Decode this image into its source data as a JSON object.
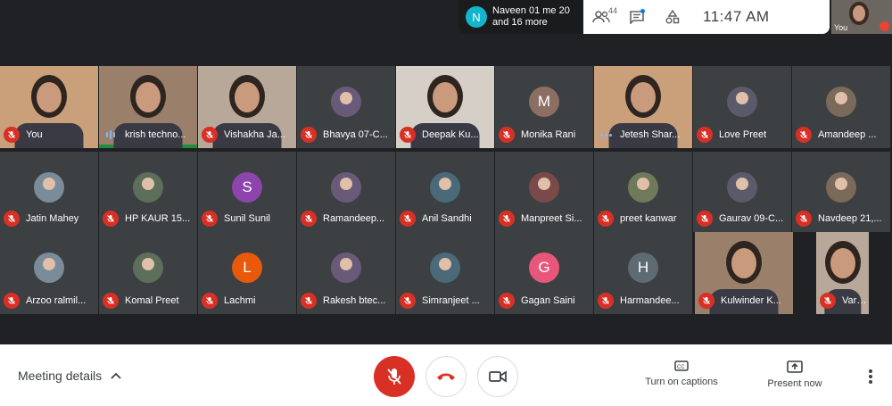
{
  "notification": {
    "avatar_letter": "N",
    "line1": "Naveen 01 me 20",
    "line2": "and 16 more"
  },
  "topbar": {
    "people_count": "44",
    "time": "11:47 AM",
    "icons": [
      "people-icon",
      "chat-icon",
      "activities-icon"
    ]
  },
  "self_view": {
    "label": "You"
  },
  "participants": {
    "row1": [
      {
        "name": "You",
        "kind": "video"
      },
      {
        "name": "krish techno...",
        "kind": "video",
        "speaking": true
      },
      {
        "name": "Vishakha Ja...",
        "kind": "video"
      },
      {
        "name": "Bhavya 07-C...",
        "kind": "photo"
      },
      {
        "name": "Deepak Ku...",
        "kind": "video"
      },
      {
        "name": "Monika Rani",
        "kind": "letter",
        "letter": "M",
        "color": "#8d6e63"
      },
      {
        "name": "Jetesh Shar...",
        "kind": "video",
        "dots": true
      },
      {
        "name": "Love Preet",
        "kind": "photo"
      },
      {
        "name": "Amandeep ...",
        "kind": "photo"
      }
    ],
    "row2": [
      {
        "name": "Jatin Mahey",
        "kind": "photo"
      },
      {
        "name": "HP KAUR 15...",
        "kind": "photo"
      },
      {
        "name": "Sunil Sunil",
        "kind": "letter",
        "letter": "S",
        "color": "#8e44ad"
      },
      {
        "name": "Ramandeep...",
        "kind": "photo"
      },
      {
        "name": "Anil Sandhi",
        "kind": "photo"
      },
      {
        "name": "Manpreet Si...",
        "kind": "photo"
      },
      {
        "name": "preet kanwar",
        "kind": "photo"
      },
      {
        "name": "Gaurav 09-C...",
        "kind": "photo"
      },
      {
        "name": "Navdeep 21,...",
        "kind": "photo"
      }
    ],
    "row3": [
      {
        "name": "Arzoo ralmil...",
        "kind": "photo"
      },
      {
        "name": "Komal Preet",
        "kind": "photo"
      },
      {
        "name": "Lachmi",
        "kind": "letter",
        "letter": "L",
        "color": "#e8590c"
      },
      {
        "name": "Rakesh btec...",
        "kind": "photo"
      },
      {
        "name": "Simranjeet ...",
        "kind": "photo"
      },
      {
        "name": "Gagan Saini",
        "kind": "letter",
        "letter": "G",
        "color": "#e8567c"
      },
      {
        "name": "Harmandee...",
        "kind": "letter",
        "letter": "H",
        "color": "#5f6b73"
      },
      {
        "name": "Kulwinder K...",
        "kind": "video"
      },
      {
        "name": "Varinder pab...",
        "kind": "video"
      }
    ]
  },
  "bottom": {
    "meeting_details": "Meeting details",
    "captions_label": "Turn on captions",
    "present_label": "Present now"
  }
}
